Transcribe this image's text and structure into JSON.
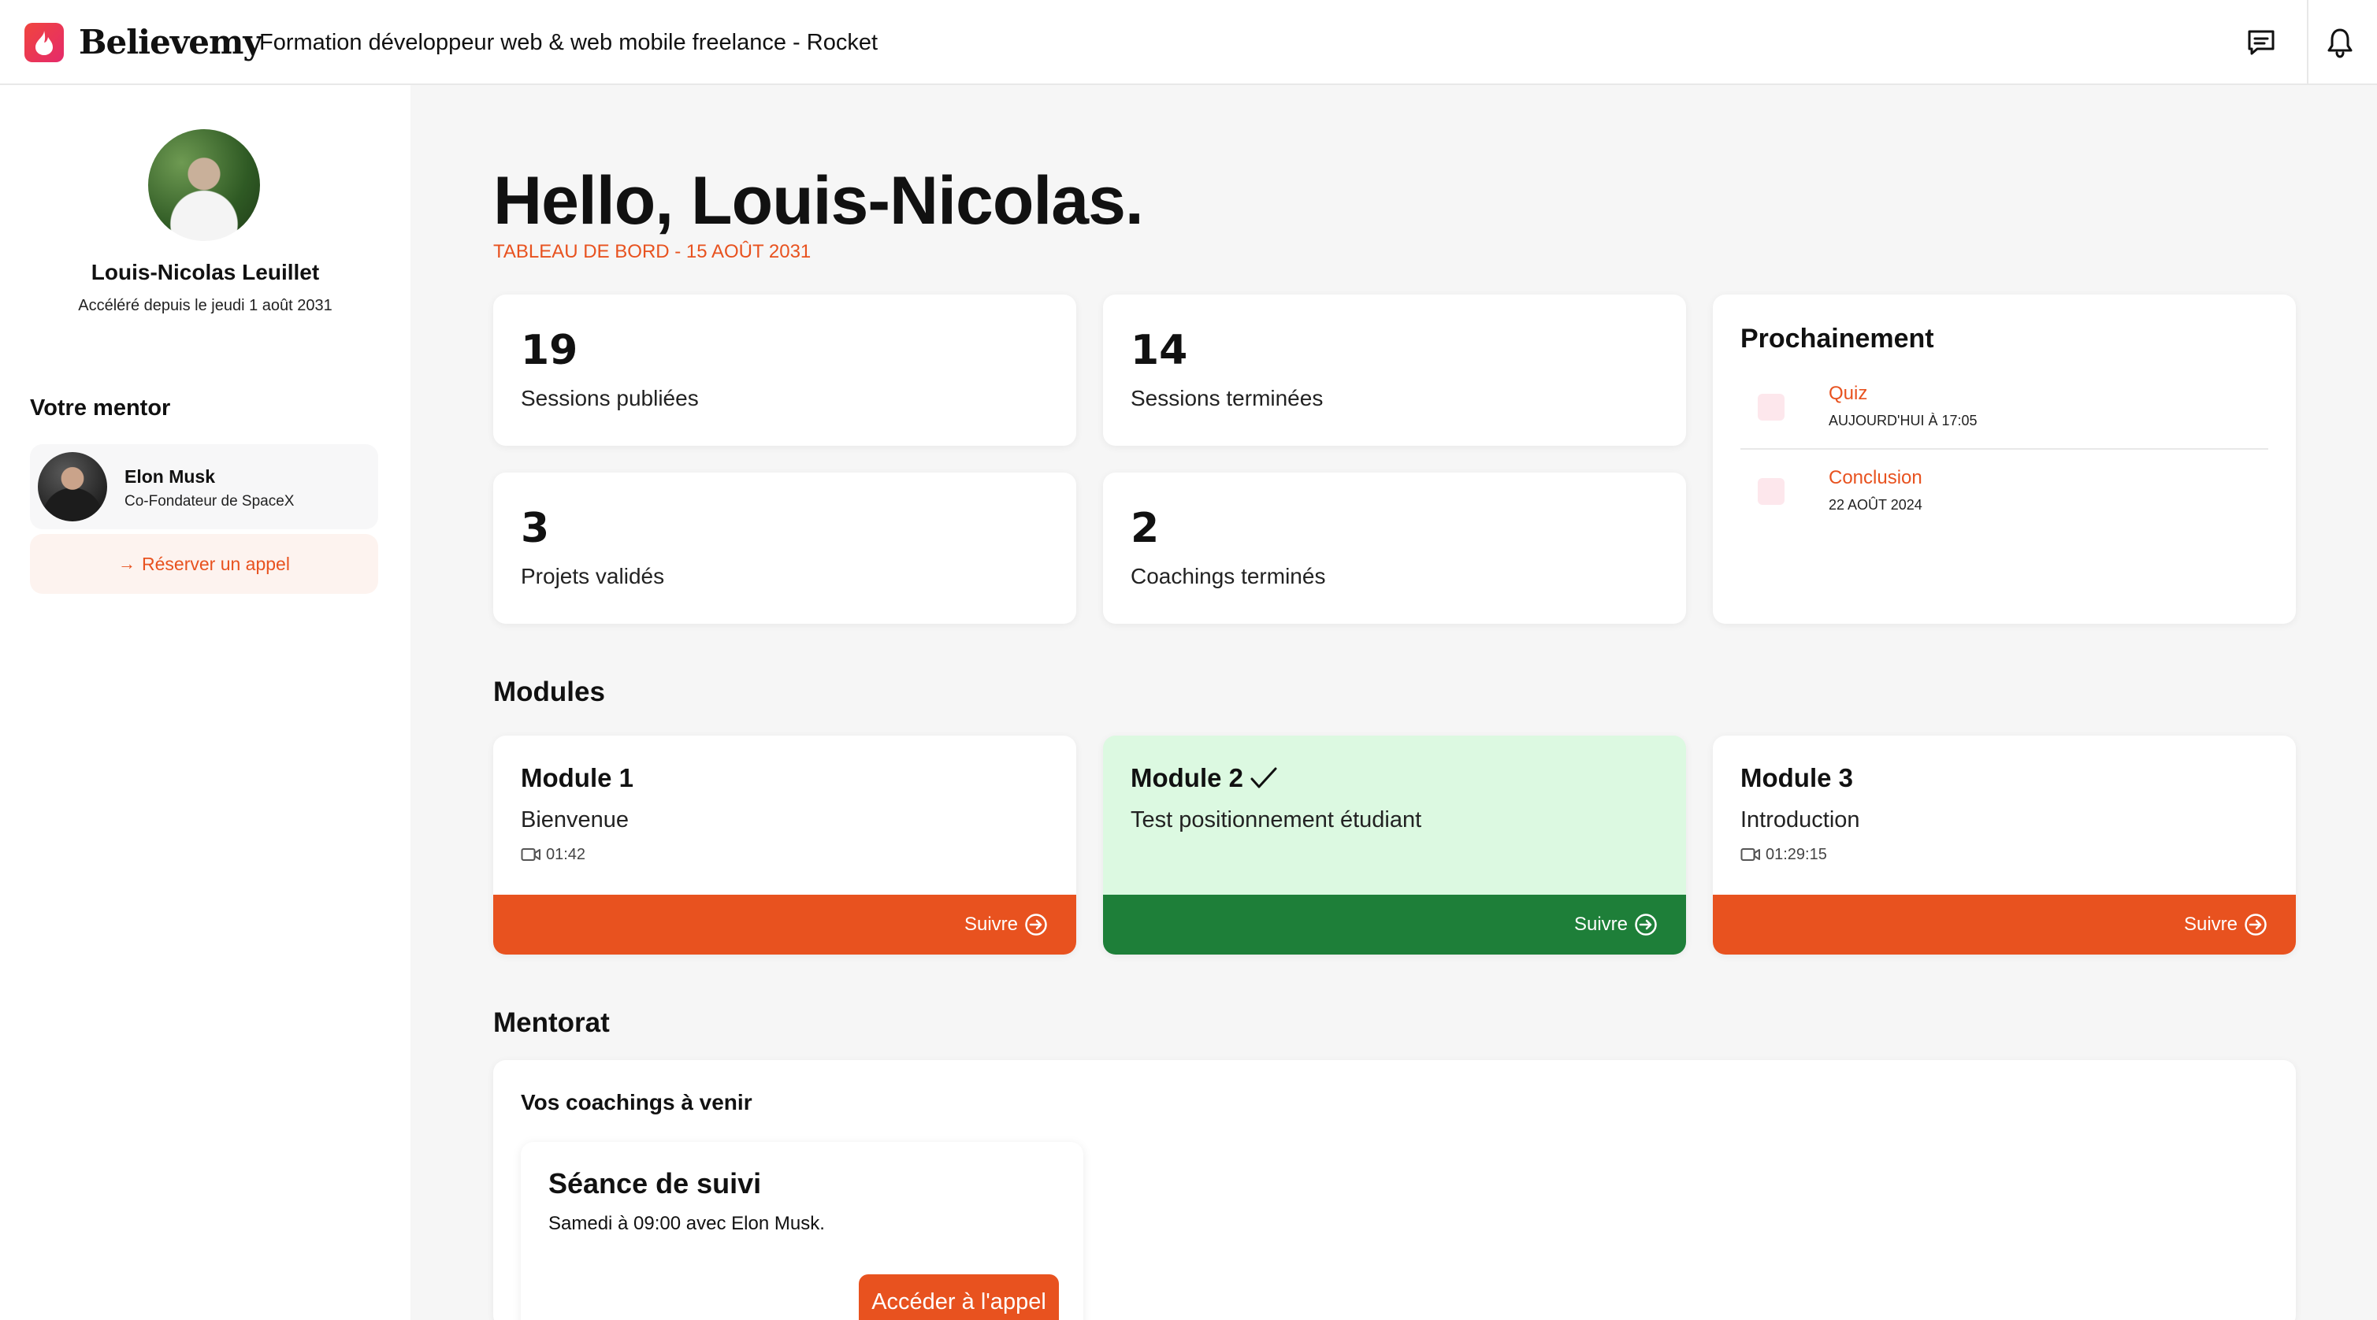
{
  "header": {
    "brand": "Believemy",
    "title": "Formation développeur web & web mobile freelance - Rocket",
    "icons": [
      "chat-icon",
      "bell-icon"
    ]
  },
  "profile": {
    "name": "Louis-Nicolas Leuillet",
    "since": "Accéléré depuis le jeudi 1 août 2031"
  },
  "mentor": {
    "heading": "Votre mentor",
    "name": "Elon Musk",
    "role": "Co-Fondateur de SpaceX",
    "book_label": "Réserver un appel"
  },
  "dashboard": {
    "greeting": "Hello, Louis-Nicolas.",
    "date": "TABLEAU DE BORD - 15 AOÛT 2031"
  },
  "stats": [
    {
      "value": "19",
      "label": "Sessions publiées"
    },
    {
      "value": "14",
      "label": "Sessions terminées"
    },
    {
      "value": "3",
      "label": "Projets validés"
    },
    {
      "value": "2",
      "label": "Coachings terminés"
    }
  ],
  "upcoming": {
    "title": "Prochainement",
    "items": [
      {
        "name": "Quiz",
        "when": "AUJOURD'HUI À 17:05"
      },
      {
        "name": "Conclusion",
        "when": "22 AOÛT 2024"
      }
    ]
  },
  "modules": {
    "title": "Modules",
    "items": [
      {
        "title": "Module 1",
        "subtitle": "Bienvenue",
        "duration": "01:42",
        "button": "Suivre",
        "completed": false
      },
      {
        "title": "Module 2",
        "subtitle": "Test positionnement étudiant",
        "duration": "",
        "button": "Suivre",
        "completed": true
      },
      {
        "title": "Module 3",
        "subtitle": "Introduction",
        "duration": "01:29:15",
        "button": "Suivre",
        "completed": false
      }
    ]
  },
  "mentoring": {
    "title": "Mentorat",
    "upcoming_heading": "Vos coachings à venir",
    "session": {
      "title": "Séance de suivi",
      "when": "Samedi à 09:00 avec Elon Musk.",
      "button": "Accéder à l'appel"
    }
  },
  "colors": {
    "accent": "#e8521f",
    "success": "#1e7f39",
    "success_bg": "#dcf9e1"
  }
}
